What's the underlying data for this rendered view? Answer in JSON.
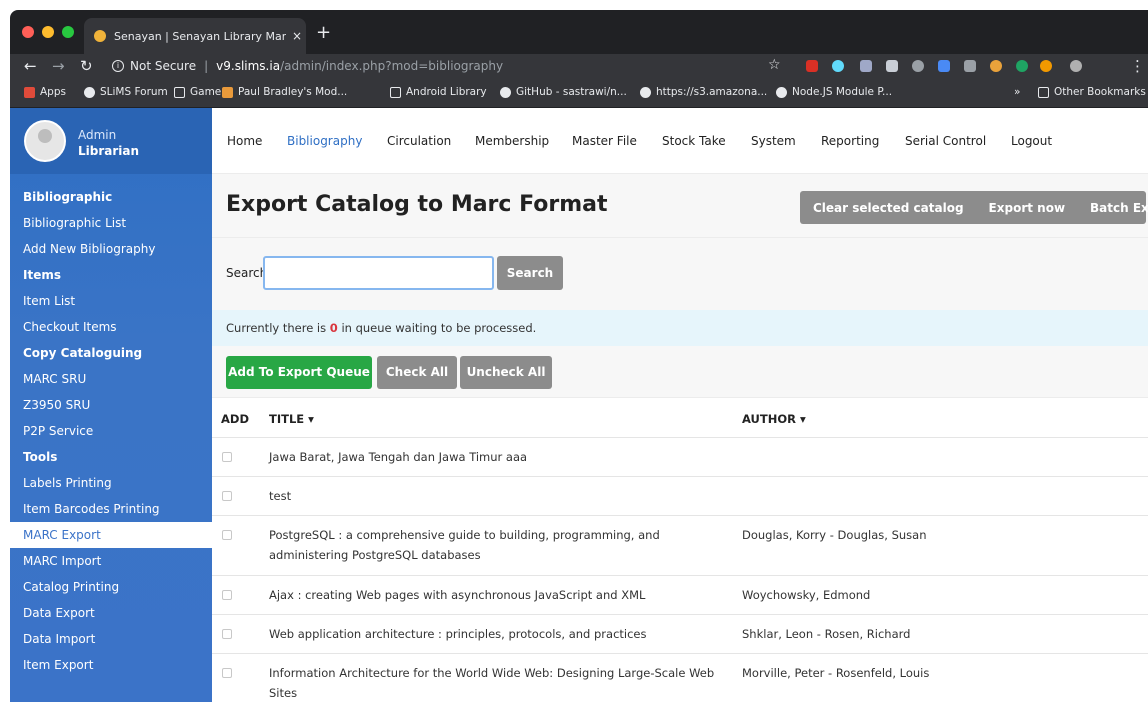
{
  "browser": {
    "tab_title": "Senayan | Senayan Library Mana",
    "tab_close": "×",
    "new_tab": "+",
    "security_label": "Not Secure",
    "url_host": "v9.slims.ia",
    "url_path": "/admin/index.php?mod=bibliography",
    "bookmarks": [
      {
        "label": "Apps",
        "icon": "apps-grid-icon",
        "color": "#e04b3a"
      },
      {
        "label": "SLiMS Forum",
        "icon": "globe-icon",
        "color": "#e8eaed"
      },
      {
        "label": "Game",
        "icon": "folder-icon",
        "color": "#e8eaed"
      },
      {
        "label": "Paul Bradley's Mod...",
        "icon": "bookmark-favicon-icon",
        "color": "#e99a3b"
      },
      {
        "label": "Android Library",
        "icon": "folder-icon",
        "color": "#e8eaed"
      },
      {
        "label": "GitHub - sastrawi/n...",
        "icon": "github-icon",
        "color": "#e8eaed"
      },
      {
        "label": "https://s3.amazona...",
        "icon": "globe-icon",
        "color": "#e8eaed"
      },
      {
        "label": "Node.JS Module P...",
        "icon": "globe-icon",
        "color": "#e8eaed"
      }
    ],
    "bookmarks_overflow": "»",
    "other_bookmarks": "Other Bookmarks"
  },
  "sidebar": {
    "user_name": "Admin",
    "user_role": "Librarian",
    "sections": [
      {
        "heading": "Bibliographic",
        "items": [
          "Bibliographic List",
          "Add New Bibliography"
        ]
      },
      {
        "heading": "Items",
        "items": [
          "Item List",
          "Checkout Items"
        ]
      },
      {
        "heading": "Copy Cataloguing",
        "items": [
          "MARC SRU",
          "Z3950 SRU",
          "P2P Service"
        ]
      },
      {
        "heading": "Tools",
        "items": [
          "Labels Printing",
          "Item Barcodes Printing",
          "MARC Export",
          "MARC Import",
          "Catalog Printing",
          "Data Export",
          "Data Import",
          "Item Export"
        ]
      }
    ],
    "active_item": "MARC Export"
  },
  "topnav": {
    "items": [
      "Home",
      "Bibliography",
      "Circulation",
      "Membership",
      "Master File",
      "Stock Take",
      "System",
      "Reporting",
      "Serial Control",
      "Logout"
    ],
    "active": "Bibliography"
  },
  "main": {
    "title": "Export Catalog to Marc Format",
    "header_buttons": [
      "Clear selected catalog",
      "Export now",
      "Batch Export"
    ],
    "search_label": "Search",
    "search_value": "",
    "search_button": "Search",
    "queue_text_before": "Currently there is ",
    "queue_count": "0",
    "queue_text_after": " in queue waiting to be processed.",
    "action_buttons": {
      "add": "Add To Export Queue",
      "check_all": "Check All",
      "uncheck_all": "Uncheck All"
    },
    "table": {
      "headers": {
        "add": "ADD",
        "title": "TITLE ▾",
        "author": "AUTHOR ▾"
      },
      "rows": [
        {
          "title": "Jawa Barat, Jawa Tengah dan Jawa Timur aaa",
          "author": ""
        },
        {
          "title": "test",
          "author": ""
        },
        {
          "title": "PostgreSQL : a comprehensive guide to building, programming, and administering PostgreSQL databases",
          "author": "Douglas, Korry - Douglas, Susan"
        },
        {
          "title": "Ajax : creating Web pages with asynchronous JavaScript and XML",
          "author": "Woychowsky, Edmond"
        },
        {
          "title": "Web application architecture : principles, protocols, and practices",
          "author": "Shklar, Leon - Rosen, Richard"
        },
        {
          "title": "Information Architecture for the World Wide Web: Designing Large-Scale Web Sites",
          "author": "Morville, Peter - Rosenfeld, Louis"
        }
      ]
    }
  },
  "colors": {
    "sidebar_blue": "#3b73c8",
    "active_link": "#2f6fc4",
    "green": "#28a745",
    "gray_button": "#8c8c8c",
    "queue_count": "#d9363e"
  }
}
